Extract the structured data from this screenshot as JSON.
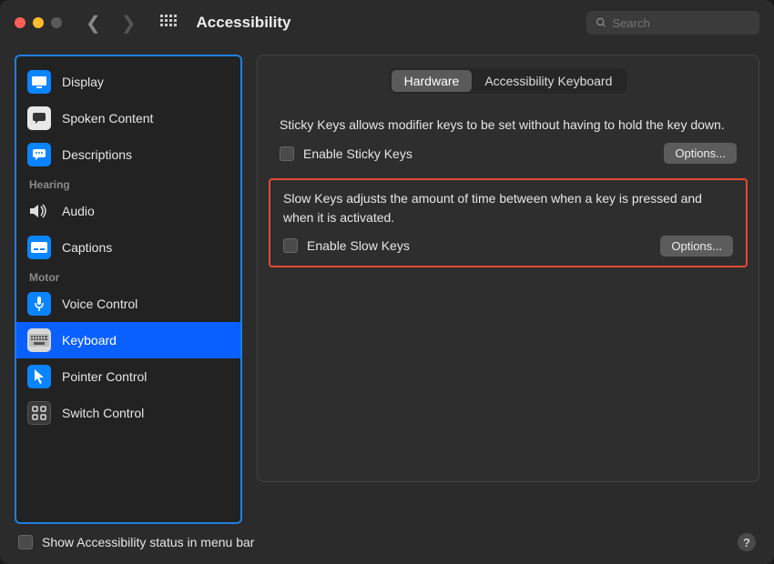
{
  "window": {
    "title": "Accessibility"
  },
  "search": {
    "placeholder": "Search"
  },
  "sidebar": {
    "sections": {
      "hearing": "Hearing",
      "motor": "Motor"
    },
    "items": {
      "display": "Display",
      "spoken": "Spoken Content",
      "descriptions": "Descriptions",
      "audio": "Audio",
      "captions": "Captions",
      "voice": "Voice Control",
      "keyboard": "Keyboard",
      "pointer": "Pointer Control",
      "switch": "Switch Control"
    }
  },
  "tabs": {
    "hardware": "Hardware",
    "a11ykb": "Accessibility Keyboard"
  },
  "sticky": {
    "desc": "Sticky Keys allows modifier keys to be set without having to hold the key down.",
    "label": "Enable Sticky Keys",
    "options": "Options..."
  },
  "slow": {
    "desc": "Slow Keys adjusts the amount of time between when a key is pressed and when it is activated.",
    "label": "Enable Slow Keys",
    "options": "Options..."
  },
  "footer": {
    "status": "Show Accessibility status in menu bar",
    "help": "?"
  }
}
